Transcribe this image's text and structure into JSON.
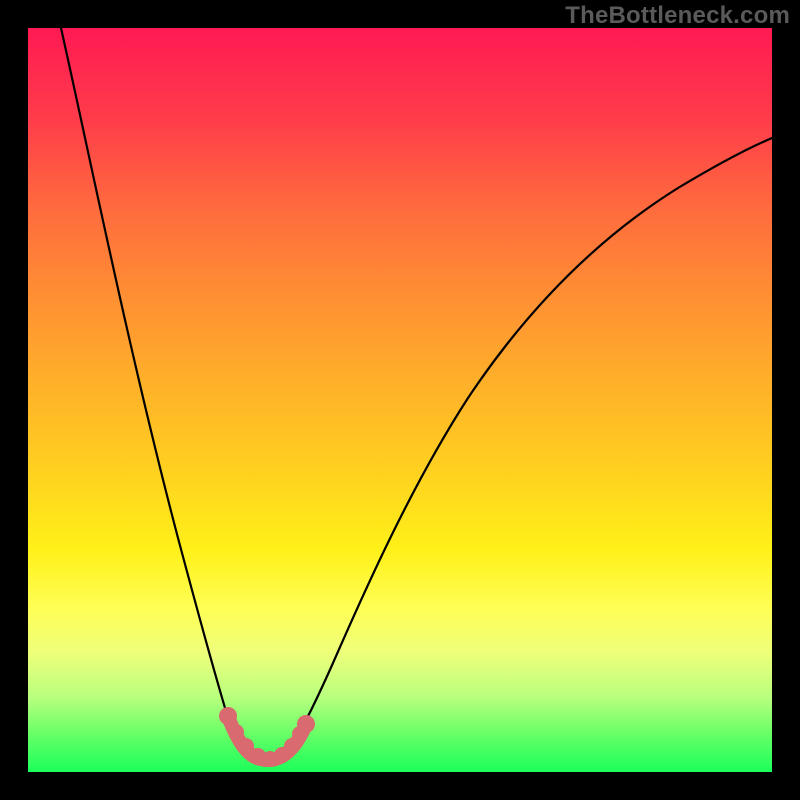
{
  "watermark": "TheBottleneck.com",
  "colors": {
    "frame": "#000000",
    "marker": "#d96a6f",
    "gradient_top": "#ff1a53",
    "gradient_bottom": "#1bff5b"
  },
  "chart_data": {
    "type": "line",
    "title": "",
    "xlabel": "",
    "ylabel": "",
    "xlim": [
      0,
      100
    ],
    "ylim": [
      0,
      100
    ],
    "x": [
      4,
      8,
      12,
      16,
      20,
      23,
      25,
      27,
      29,
      31,
      33,
      36,
      40,
      45,
      50,
      55,
      60,
      65,
      70,
      75,
      80,
      85,
      90,
      95,
      100
    ],
    "values": [
      100,
      82,
      65,
      48,
      33,
      21,
      13,
      7,
      3,
      2,
      3,
      7,
      15,
      25,
      35,
      44,
      52,
      59,
      65,
      70,
      74,
      77,
      80,
      82,
      84
    ],
    "optimum_x": 30,
    "optimum_y": 2,
    "marker_band_x": [
      25,
      34
    ],
    "annotations": []
  }
}
